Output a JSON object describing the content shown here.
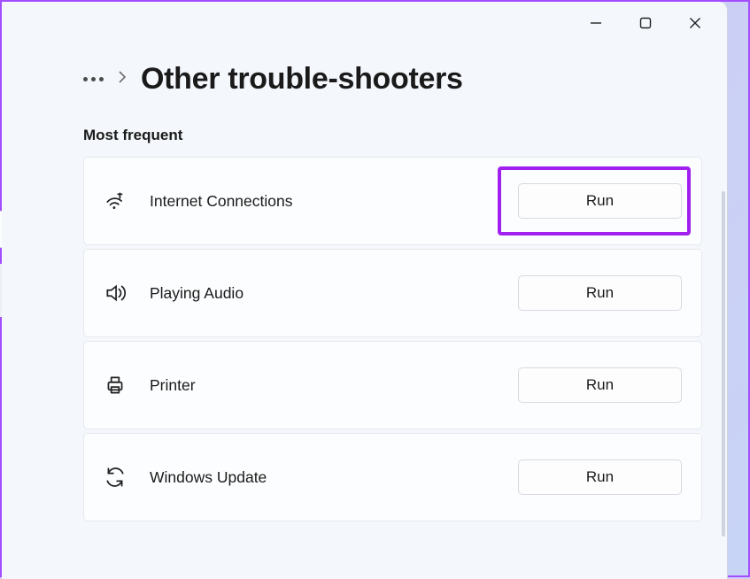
{
  "header": {
    "title": "Other trouble-shooters"
  },
  "section": {
    "label": "Most frequent"
  },
  "items": [
    {
      "id": "internet-connections",
      "label": "Internet Connections",
      "button": "Run",
      "highlighted": true,
      "icon": "wifi"
    },
    {
      "id": "playing-audio",
      "label": "Playing Audio",
      "button": "Run",
      "highlighted": false,
      "icon": "audio"
    },
    {
      "id": "printer",
      "label": "Printer",
      "button": "Run",
      "highlighted": false,
      "icon": "printer"
    },
    {
      "id": "windows-update",
      "label": "Windows Update",
      "button": "Run",
      "highlighted": false,
      "icon": "sync"
    }
  ],
  "titlebar": {
    "minimize": "Minimize",
    "maximize": "Maximize",
    "close": "Close"
  },
  "colors": {
    "highlight": "#a020f0",
    "window_bg": "#f4f7fc"
  }
}
